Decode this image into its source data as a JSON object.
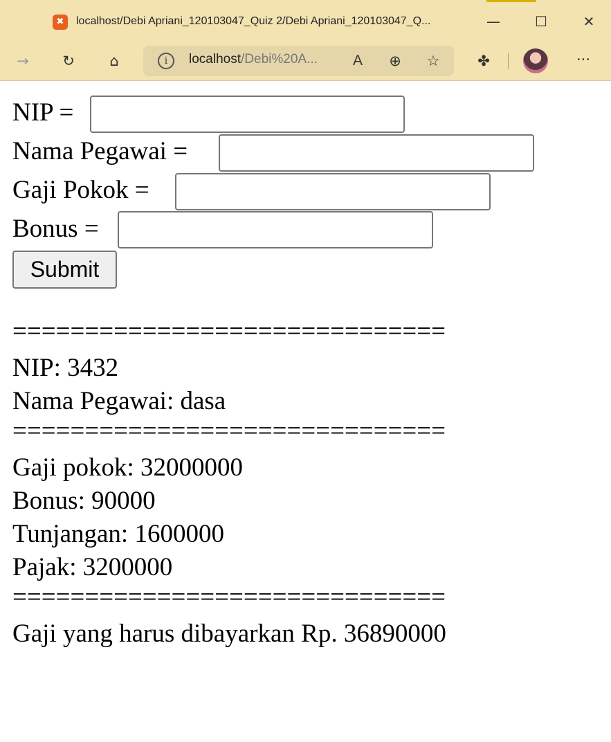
{
  "browser": {
    "tab_title": "localhost/Debi Apriani_120103047_Quiz 2/Debi Apriani_120103047_Q...",
    "favicon_glyph": "✖",
    "url_host": "localhost",
    "url_path": "/Debi%20A...",
    "icons": {
      "back": "→",
      "refresh": "↻",
      "home": "⌂",
      "minimize": "—",
      "maximize": "☐",
      "close": "✕",
      "info": "i",
      "read_aloud": "A",
      "zoom": "⊕",
      "favorite": "☆",
      "extensions": "✤",
      "more": "···"
    }
  },
  "form": {
    "nip_label": "NIP =",
    "nama_label": "Nama Pegawai =",
    "gaji_label": "Gaji Pokok =",
    "bonus_label": "Bonus =",
    "nip_value": "",
    "nama_value": "",
    "gaji_value": "",
    "bonus_value": "",
    "submit_label": "Submit"
  },
  "result": {
    "separator": "==============================",
    "nip": "NIP: 3432",
    "nama": "Nama Pegawai: dasa",
    "gaji_pokok": "Gaji pokok: 32000000",
    "bonus": "Bonus: 90000",
    "tunjangan": "Tunjangan: 1600000",
    "pajak": "Pajak: 3200000",
    "total": "Gaji yang harus dibayarkan Rp. 36890000"
  }
}
